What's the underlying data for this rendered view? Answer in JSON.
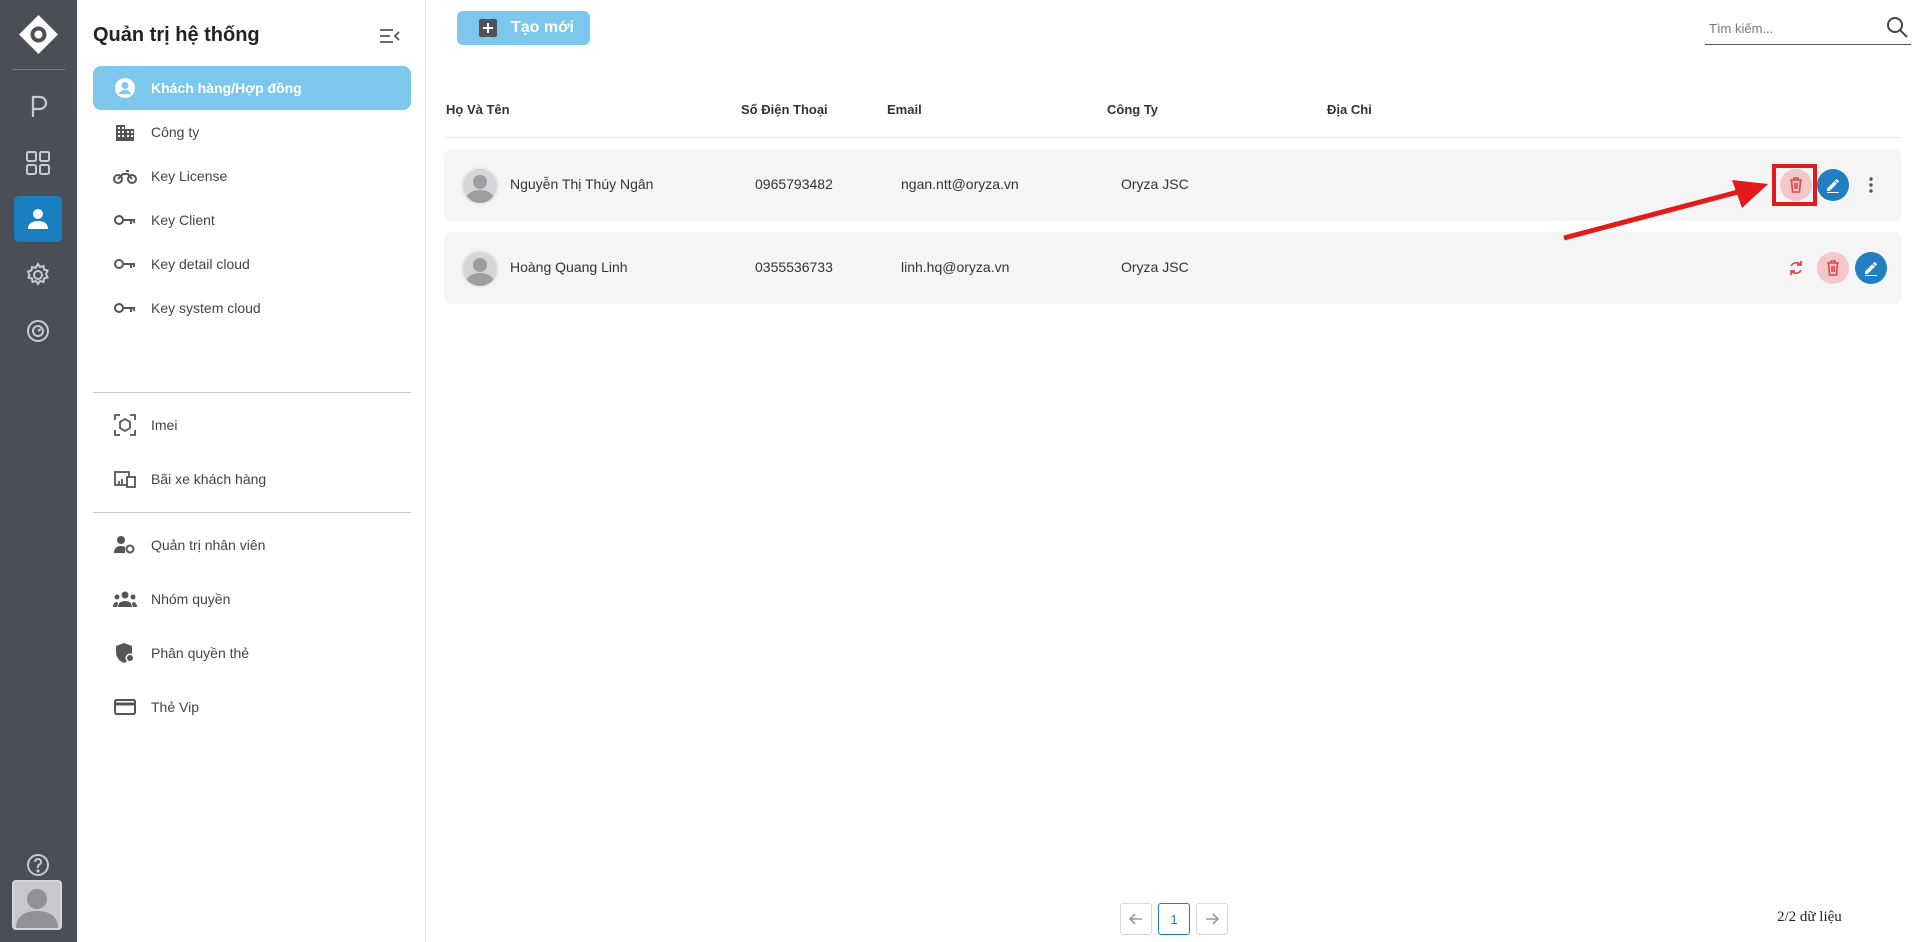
{
  "rail": {
    "items": [
      {
        "icon": "parking-icon"
      },
      {
        "icon": "grid-icon"
      },
      {
        "icon": "user-icon",
        "active": true
      },
      {
        "icon": "gear-icon"
      },
      {
        "icon": "timer-icon"
      }
    ],
    "help_icon": "help-circle-icon"
  },
  "sidebar": {
    "title": "Quản trị hệ thống",
    "items": [
      {
        "label": "Khách hàng/Hợp đồng",
        "icon": "account-circle-icon",
        "active": true
      },
      {
        "label": "Công ty",
        "icon": "building-icon"
      },
      {
        "label": "Key License",
        "icon": "motorbike-icon"
      },
      {
        "label": "Key Client",
        "icon": "key-icon"
      },
      {
        "label": "Key detail cloud",
        "icon": "key-icon"
      },
      {
        "label": "Key system cloud",
        "icon": "key-icon"
      },
      {
        "label": "Imei",
        "icon": "scan-cube-icon"
      },
      {
        "label": "Bãi xe khách hàng",
        "icon": "devices-icon"
      },
      {
        "label": "Quản trị nhân viên",
        "icon": "user-gear-icon"
      },
      {
        "label": "Nhóm quyền",
        "icon": "group-icon"
      },
      {
        "label": "Phân quyền thẻ",
        "icon": "shield-icon"
      },
      {
        "label": "Thẻ Vip",
        "icon": "card-icon"
      }
    ]
  },
  "toolbar": {
    "create_label": "Tạo mới",
    "search_placeholder": "Tìm kiếm..."
  },
  "table": {
    "columns": [
      "Họ Và Tên",
      "Số Điện Thoại",
      "Email",
      "Công Ty",
      "Địa Chỉ"
    ],
    "rows": [
      {
        "name": "Nguyễn Thị Thúy Ngân",
        "phone": "0965793482",
        "email": "ngan.ntt@oryza.vn",
        "company": "Oryza JSC",
        "address": ""
      },
      {
        "name": "Hoàng Quang Linh",
        "phone": "0355536733",
        "email": "linh.hq@oryza.vn",
        "company": "Oryza JSC",
        "address": ""
      }
    ]
  },
  "pagination": {
    "current_page": "1",
    "count_text": "2/2 dữ liệu"
  },
  "colors": {
    "rail_bg": "#4b4e55",
    "accent": "#1a7fc1",
    "active_item_bg": "#7cc8ec",
    "delete_bg": "#f4c7c9",
    "annotation_red": "#e21c1c"
  }
}
